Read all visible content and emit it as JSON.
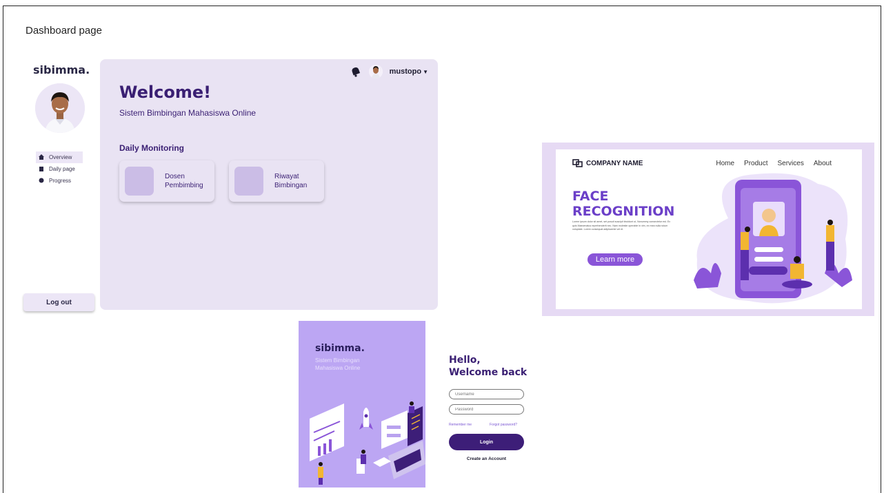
{
  "page_title": "Dashboard page",
  "dashboard": {
    "brand": "sibimma.",
    "nav": [
      {
        "label": "Overview",
        "icon": "home-icon"
      },
      {
        "label": "Daily page",
        "icon": "book-icon"
      },
      {
        "label": "Progress",
        "icon": "progress-icon"
      }
    ],
    "logout_label": "Log out",
    "user": {
      "name": "mustopo"
    },
    "welcome": "Welcome!",
    "subtitle": "Sistem Bimbingan Mahasiswa Online",
    "section_title": "Daily Monitoring",
    "cards": [
      {
        "label": "Dosen Pembimbing"
      },
      {
        "label": "Riwayat Bimbingan"
      }
    ]
  },
  "landing": {
    "company": "COMPANY NAME",
    "nav": [
      "Home",
      "Product",
      "Services",
      "About"
    ],
    "title_line1": "FACE",
    "title_line2": "RECOGNITION",
    "body_text": "Lorem ipsum dolor sit amet, set posuit suscipit tincidunt ut, Nonummy consectetur est. Ex quis Maecenatus reprehenderit nec. Nam molestie operable in vim, ex mea nulla rutum voluptate. Lorem consequat adipiscente vel et.",
    "button": "Learn more"
  },
  "login": {
    "brand": "sibimma.",
    "tagline": "Sistem Bimbingan Mahasiswa Online",
    "hello_line1": "Hello,",
    "hello_line2": "Welcome back",
    "username_placeholder": "Username",
    "password_placeholder": "Password",
    "remember": "Remember me",
    "forgot": "Forgot password?",
    "login_button": "Login",
    "create_account": "Create an Account"
  },
  "colors": {
    "primary": "#3a1f73",
    "panel": "#e9e3f3",
    "accent": "#8a55d8",
    "login_panel": "#bca6f3"
  }
}
